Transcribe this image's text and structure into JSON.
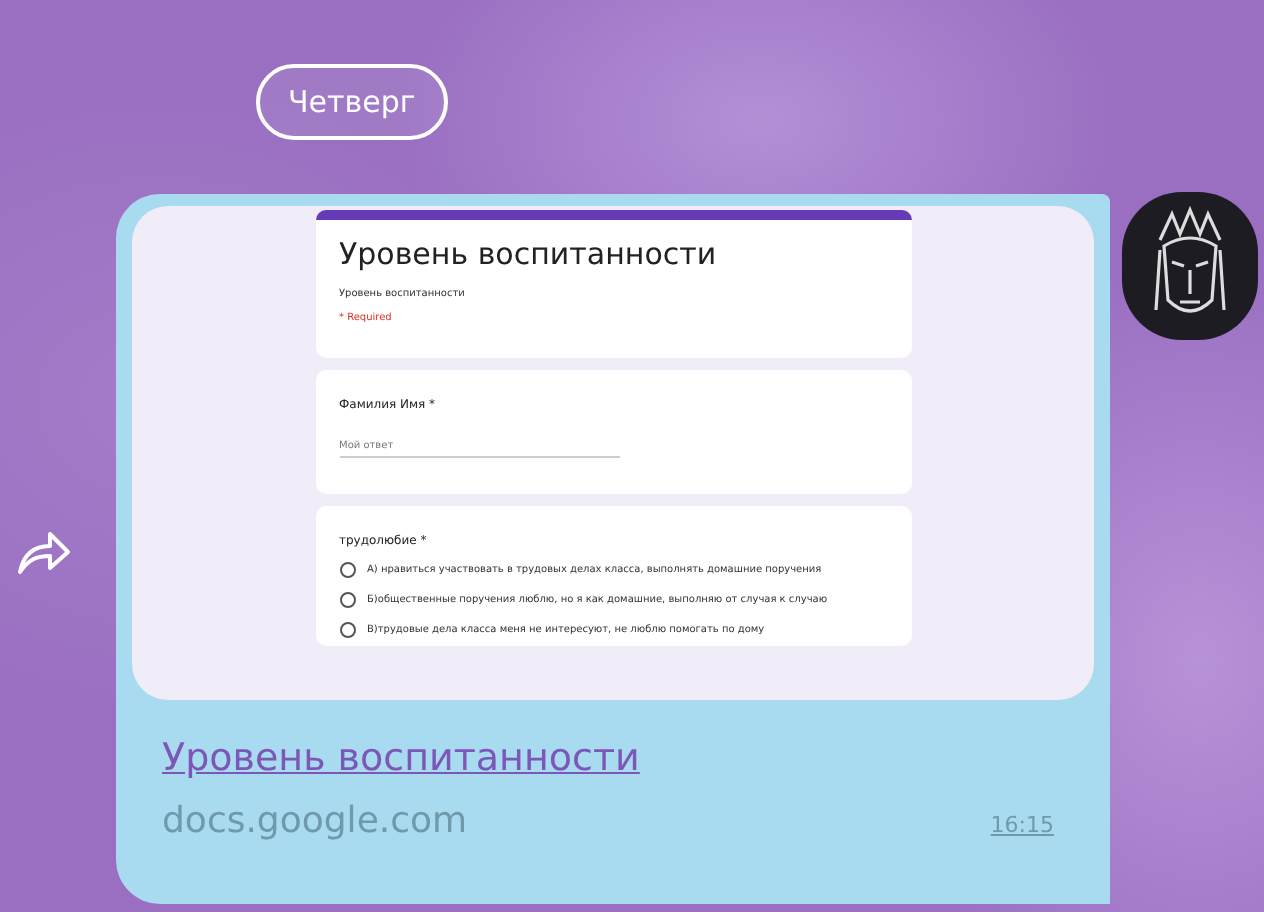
{
  "date_chip": "Четверг",
  "message": {
    "form_preview": {
      "title": "Уровень воспитанности",
      "description": "Уровень воспитанности",
      "required_note": "* Required",
      "questions": [
        {
          "kind": "text",
          "label": "Фамилия Имя *",
          "placeholder": "Мой ответ"
        },
        {
          "kind": "radio",
          "label": "трудолюбие *",
          "options": [
            {
              "label": "А) нравиться участвовать в трудовых делах класса, выполнять домашние поручения",
              "selected": false
            },
            {
              "label": "Б)общественные поручения люблю, но я как домашние, выполняю от случая к случаю",
              "selected": false
            },
            {
              "label": "В)трудовые дела класса меня не интересуют, не люблю помогать по дому",
              "selected": false
            }
          ]
        }
      ]
    },
    "link_title": "Уровень воспитанности",
    "domain": "docs.google.com",
    "time": "16:15"
  }
}
